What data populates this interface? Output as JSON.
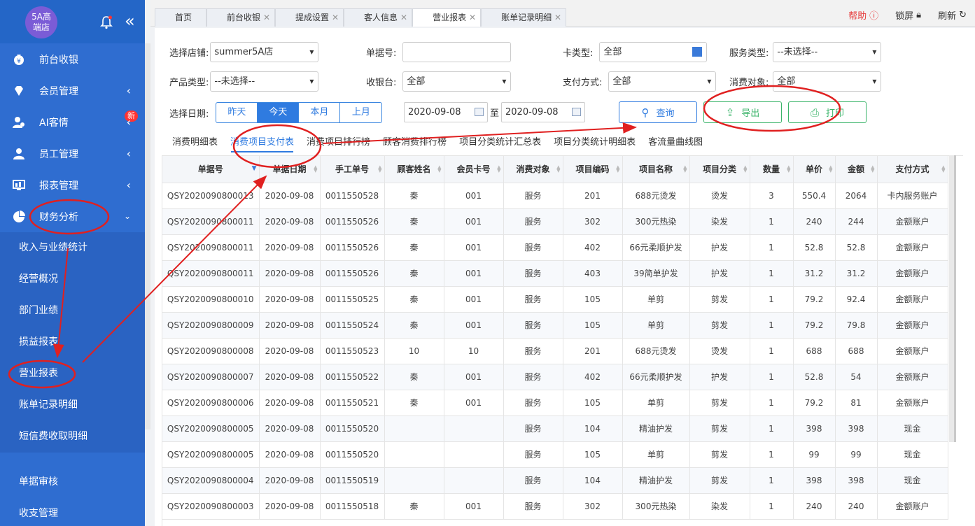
{
  "sidebar": {
    "store_name": "5A高端店",
    "logo_line1": "5A高",
    "logo_line2": "端店",
    "menu": [
      {
        "label": "前台收银"
      },
      {
        "label": "会员管理"
      },
      {
        "label": "AI客情",
        "badge": "新"
      },
      {
        "label": "员工管理"
      },
      {
        "label": "报表管理"
      },
      {
        "label": "财务分析"
      }
    ],
    "submenu": [
      "收入与业绩统计",
      "经营概况",
      "部门业绩",
      "损益报表",
      "营业报表",
      "账单记录明细",
      "短信费收取明细"
    ],
    "submenu2": [
      "单据审核",
      "收支管理"
    ]
  },
  "tabs": [
    {
      "label": "首页"
    },
    {
      "label": "前台收银"
    },
    {
      "label": "提成设置"
    },
    {
      "label": "客人信息"
    },
    {
      "label": "营业报表",
      "active": true
    },
    {
      "label": "账单记录明细"
    }
  ],
  "topbar": {
    "help": "帮助",
    "lock": "锁屏",
    "refresh": "刷新"
  },
  "filters": {
    "store_label": "选择店铺:",
    "store_value": "summer5A店",
    "bill_label": "单据号:",
    "bill_value": "",
    "card_label": "卡类型:",
    "card_value": "全部",
    "service_label": "服务类型:",
    "service_value": "--未选择--",
    "product_label": "产品类型:",
    "product_value": "--未选择--",
    "cashier_label": "收银台:",
    "cashier_value": "全部",
    "pay_label": "支付方式:",
    "pay_value": "全部",
    "target_label": "消费对象:",
    "target_value": "全部",
    "date_label": "选择日期:",
    "quick": [
      "昨天",
      "今天",
      "本月",
      "上月"
    ],
    "date_from": "2020-09-08",
    "date_sep": "至",
    "date_to": "2020-09-08",
    "query": "查询",
    "export": "导出",
    "print": "打印"
  },
  "report_tabs": [
    "消费明细表",
    "消费项目支付表",
    "消费项目排行榜",
    "顾客消费排行榜",
    "项目分类统计汇总表",
    "项目分类统计明细表",
    "客流量曲线图"
  ],
  "table": {
    "headers": [
      "单据号",
      "单据日期",
      "手工单号",
      "顾客姓名",
      "会员卡号",
      "消费对象",
      "项目编码",
      "项目名称",
      "项目分类",
      "数量",
      "单价",
      "金额",
      "支付方式"
    ],
    "rows": [
      [
        "QSY2020090800013",
        "2020-09-08",
        "0011550528",
        "秦",
        "001",
        "服务",
        "201",
        "688元烫发",
        "烫发",
        "3",
        "550.4",
        "2064",
        "卡内服务账户"
      ],
      [
        "QSY2020090800011",
        "2020-09-08",
        "0011550526",
        "秦",
        "001",
        "服务",
        "302",
        "300元热染",
        "染发",
        "1",
        "240",
        "244",
        "金额账户"
      ],
      [
        "QSY2020090800011",
        "2020-09-08",
        "0011550526",
        "秦",
        "001",
        "服务",
        "402",
        "66元柔顺护发",
        "护发",
        "1",
        "52.8",
        "52.8",
        "金额账户"
      ],
      [
        "QSY2020090800011",
        "2020-09-08",
        "0011550526",
        "秦",
        "001",
        "服务",
        "403",
        "39简单护发",
        "护发",
        "1",
        "31.2",
        "31.2",
        "金额账户"
      ],
      [
        "QSY2020090800010",
        "2020-09-08",
        "0011550525",
        "秦",
        "001",
        "服务",
        "105",
        "单剪",
        "剪发",
        "1",
        "79.2",
        "92.4",
        "金额账户"
      ],
      [
        "QSY2020090800009",
        "2020-09-08",
        "0011550524",
        "秦",
        "001",
        "服务",
        "105",
        "单剪",
        "剪发",
        "1",
        "79.2",
        "79.8",
        "金额账户"
      ],
      [
        "QSY2020090800008",
        "2020-09-08",
        "0011550523",
        "10",
        "10",
        "服务",
        "201",
        "688元烫发",
        "烫发",
        "1",
        "688",
        "688",
        "金额账户"
      ],
      [
        "QSY2020090800007",
        "2020-09-08",
        "0011550522",
        "秦",
        "001",
        "服务",
        "402",
        "66元柔顺护发",
        "护发",
        "1",
        "52.8",
        "54",
        "金额账户"
      ],
      [
        "QSY2020090800006",
        "2020-09-08",
        "0011550521",
        "秦",
        "001",
        "服务",
        "105",
        "单剪",
        "剪发",
        "1",
        "79.2",
        "81",
        "金额账户"
      ],
      [
        "QSY2020090800005",
        "2020-09-08",
        "0011550520",
        "",
        "",
        "服务",
        "104",
        "精油护发",
        "剪发",
        "1",
        "398",
        "398",
        "现金"
      ],
      [
        "QSY2020090800005",
        "2020-09-08",
        "0011550520",
        "",
        "",
        "服务",
        "105",
        "单剪",
        "剪发",
        "1",
        "99",
        "99",
        "现金"
      ],
      [
        "QSY2020090800004",
        "2020-09-08",
        "0011550519",
        "",
        "",
        "服务",
        "104",
        "精油护发",
        "剪发",
        "1",
        "398",
        "398",
        "现金"
      ],
      [
        "QSY2020090800003",
        "2020-09-08",
        "0011550518",
        "秦",
        "001",
        "服务",
        "302",
        "300元热染",
        "染发",
        "1",
        "240",
        "240",
        "金额账户"
      ]
    ]
  },
  "colors": {
    "sidebar": "#2f6dd0",
    "accent": "#2f7be0",
    "green": "#3bb46a",
    "annotation": "#e02020"
  }
}
